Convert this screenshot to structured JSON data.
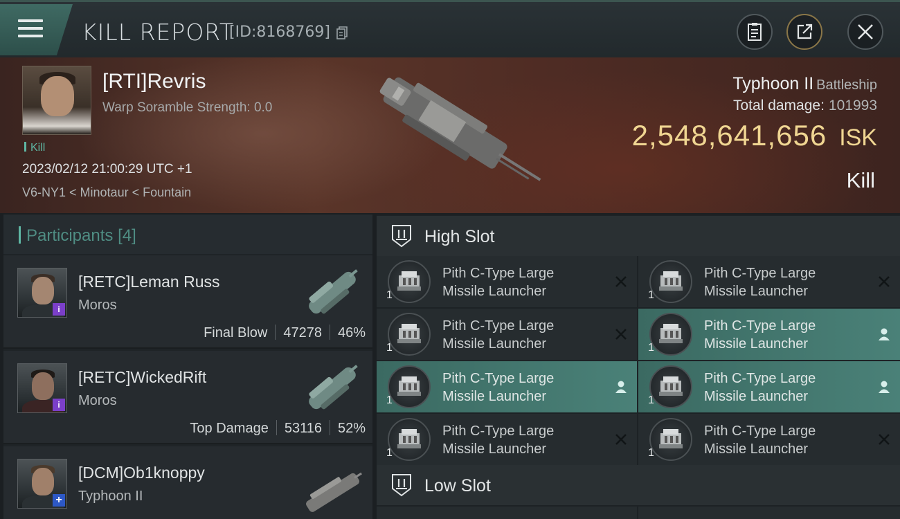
{
  "header": {
    "title": "KILL REPORT",
    "report_id": "[ID:8168769]",
    "icons": [
      "menu-icon",
      "copy-icon",
      "clipboard-icon",
      "share-icon",
      "close-icon"
    ]
  },
  "victim": {
    "name": "[RTI]Revris",
    "scramble": "Warp Soramble Strength: 0.0",
    "tag": "Kill",
    "datetime": "2023/02/12 21:00:29 UTC +1",
    "location": "V6-NY1 < Minotaur < Fountain",
    "ship_name": "Typhoon II",
    "ship_class": "Battleship",
    "total_damage_label": "Total damage:",
    "total_damage": "101993",
    "isk_value": "2,548,641,656",
    "isk_unit": "ISK",
    "result": "Kill"
  },
  "participants": {
    "title": "Participants",
    "count": "[4]",
    "items": [
      {
        "name": "[RETC]Leman Russ",
        "ship": "Moros",
        "label": "Final Blow",
        "damage": "47278",
        "percent": "46%",
        "badge": "i"
      },
      {
        "name": "[RETC]WickedRift",
        "ship": "Moros",
        "label": "Top Damage",
        "damage": "53116",
        "percent": "52%",
        "badge": "i"
      },
      {
        "name": "[DCM]Ob1knoppy",
        "ship": "Typhoon II",
        "label": "",
        "damage": "",
        "percent": "",
        "badge": "+"
      }
    ]
  },
  "fitting": {
    "high_slot_title": "High Slot",
    "low_slot_title": "Low Slot",
    "high_slot": [
      {
        "name_line1": "Pith C-Type Large",
        "name_line2": "Missile Launcher",
        "qty": "1",
        "state": "destroyed"
      },
      {
        "name_line1": "Pith C-Type Large",
        "name_line2": "Missile Launcher",
        "qty": "1",
        "state": "destroyed"
      },
      {
        "name_line1": "Pith C-Type Large",
        "name_line2": "Missile Launcher",
        "qty": "1",
        "state": "destroyed"
      },
      {
        "name_line1": "Pith C-Type Large",
        "name_line2": "Missile Launcher",
        "qty": "1",
        "state": "dropped"
      },
      {
        "name_line1": "Pith C-Type Large",
        "name_line2": "Missile Launcher",
        "qty": "1",
        "state": "dropped"
      },
      {
        "name_line1": "Pith C-Type Large",
        "name_line2": "Missile Launcher",
        "qty": "1",
        "state": "dropped"
      },
      {
        "name_line1": "Pith C-Type Large",
        "name_line2": "Missile Launcher",
        "qty": "1",
        "state": "destroyed"
      },
      {
        "name_line1": "Pith C-Type Large",
        "name_line2": "Missile Launcher",
        "qty": "1",
        "state": "destroyed"
      }
    ]
  },
  "colors": {
    "accent_teal": "#5fb7a4",
    "isk_gold": "#f0d692",
    "dropped_highlight": "#4a8178"
  }
}
